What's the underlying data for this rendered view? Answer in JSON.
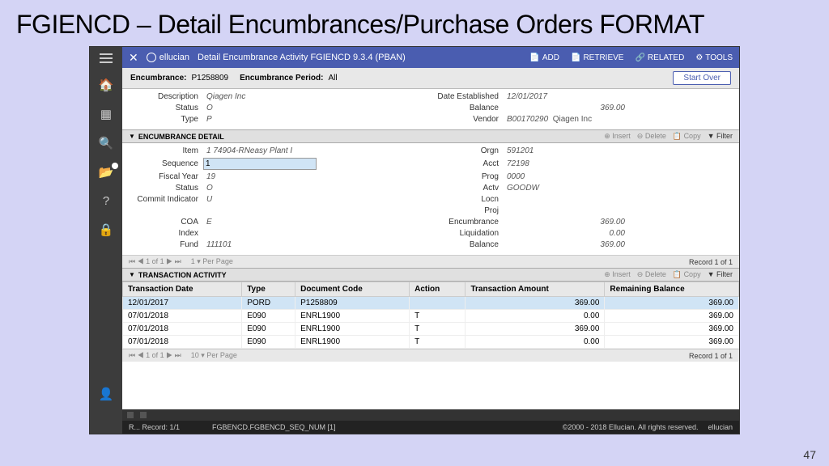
{
  "slide": {
    "title": "FGIENCD – Detail Encumbrances/Purchase Orders FORMAT",
    "page": "47"
  },
  "titlebar": {
    "brand": "ellucian",
    "title": "Detail Encumbrance Activity FGIENCD 9.3.4 (PBAN)",
    "add": "ADD",
    "retrieve": "RETRIEVE",
    "related": "RELATED",
    "tools": "TOOLS"
  },
  "keyblock": {
    "enc_label": "Encumbrance:",
    "enc_value": "P1258809",
    "period_label": "Encumbrance Period:",
    "period_value": "All",
    "startover": "Start Over"
  },
  "header": {
    "desc_l": "Description",
    "desc_v": "Qiagen Inc",
    "status_l": "Status",
    "status_v": "O",
    "type_l": "Type",
    "type_v": "P",
    "date_l": "Date Established",
    "date_v": "12/01/2017",
    "bal_l": "Balance",
    "bal_v": "369.00",
    "vendor_l": "Vendor",
    "vendor_code": "B00170290",
    "vendor_name": "Qiagen Inc"
  },
  "section1": {
    "title": "ENCUMBRANCE DETAIL",
    "insert": "Insert",
    "delete": "Delete",
    "copy": "Copy",
    "filter": "Filter"
  },
  "detail": {
    "item_l": "Item",
    "item_v": "1   74904-RNeasy Plant I",
    "seq_l": "Sequence",
    "seq_v": "1",
    "fy_l": "Fiscal Year",
    "fy_v": "19",
    "status_l": "Status",
    "status_v": "O",
    "ci_l": "Commit Indicator",
    "ci_v": "U",
    "coa_l": "COA",
    "coa_v": "E",
    "index_l": "Index",
    "index_v": "",
    "fund_l": "Fund",
    "fund_v": "111101",
    "orgn_l": "Orgn",
    "orgn_v": "591201",
    "acct_l": "Acct",
    "acct_v": "72198",
    "prog_l": "Prog",
    "prog_v": "0000",
    "actv_l": "Actv",
    "actv_v": "GOODW",
    "locn_l": "Locn",
    "locn_v": "",
    "proj_l": "Proj",
    "proj_v": "",
    "enc_l": "Encumbrance",
    "enc_v": "369.00",
    "liq_l": "Liquidation",
    "liq_v": "0.00",
    "bal_l": "Balance",
    "bal_v": "369.00"
  },
  "pager1": {
    "nav": "⏮ ◀ 1 of 1 ▶ ⏭",
    "perpage": "1 ▾  Per Page",
    "record": "Record 1 of 1"
  },
  "section2": {
    "title": "TRANSACTION ACTIVITY"
  },
  "tcols": {
    "date": "Transaction Date",
    "type": "Type",
    "doc": "Document Code",
    "action": "Action",
    "amt": "Transaction Amount",
    "bal": "Remaining Balance"
  },
  "trows": [
    {
      "date": "12/01/2017",
      "type": "PORD",
      "doc": "P1258809",
      "action": "",
      "amt": "369.00",
      "bal": "369.00"
    },
    {
      "date": "07/01/2018",
      "type": "E090",
      "doc": "ENRL1900",
      "action": "T",
      "amt": "0.00",
      "bal": "369.00"
    },
    {
      "date": "07/01/2018",
      "type": "E090",
      "doc": "ENRL1900",
      "action": "T",
      "amt": "369.00",
      "bal": "369.00"
    },
    {
      "date": "07/01/2018",
      "type": "E090",
      "doc": "ENRL1900",
      "action": "T",
      "amt": "0.00",
      "bal": "369.00"
    }
  ],
  "pager2": {
    "nav": "⏮ ◀ 1 of 1 ▶ ⏭",
    "perpage": "10 ▾  Per Page",
    "record": "Record 1 of 1"
  },
  "status": {
    "rec": "R...     Record: 1/1",
    "path": "FGBENCD.FGBENCD_SEQ_NUM [1]",
    "copy": "©2000 - 2018 Ellucian. All rights reserved.",
    "brand": "ellucian"
  }
}
